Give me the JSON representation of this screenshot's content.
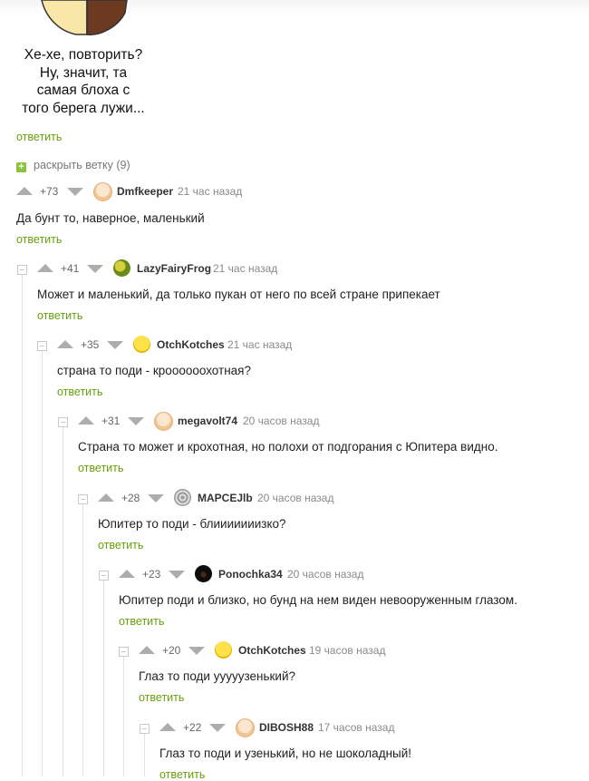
{
  "meme": {
    "caption": "Хе-хе, повторить?\nНу, значит, та\nсамая блоха с\nтого берега лужи..."
  },
  "reply_label": "ответить",
  "expand_branch": "раскрыть ветку (9)",
  "comments": [
    {
      "rating": "+73",
      "author": "Dmfkeeper",
      "time": "21 час назад",
      "text": "Да бунт то, наверное, маленький",
      "avatar": "smiley-face-icon"
    },
    {
      "rating": "+41",
      "author": "LazyFairyFrog",
      "time": "21 час назад",
      "text": "Может и маленький, да только пукан от него по всей стране припекает",
      "avatar": "frog-icon"
    },
    {
      "rating": "+35",
      "author": "OtchKotches",
      "time": "21 час назад",
      "text": "страна то поди - кроооооохотная?",
      "avatar": "winking-face-icon"
    },
    {
      "rating": "+31",
      "author": "megavolt74",
      "time": "20 часов назад",
      "text": "Страна то может и крохотная, но полохи от подгорания с Юпитера видно.",
      "avatar": "smiley-face-icon"
    },
    {
      "rating": "+28",
      "author": "MAPCEJlb",
      "time": "20 часов назад",
      "text": "Юпитер то поди - блииииииизко?",
      "avatar": "pattern-icon"
    },
    {
      "rating": "+23",
      "author": "Ponochka34",
      "time": "20 часов назад",
      "text": "Юпитер поди и близко, но бунд на нем виден невооруженным глазом.",
      "avatar": "dark-creature-icon"
    },
    {
      "rating": "+20",
      "author": "OtchKotches",
      "time": "19 часов назад",
      "text": "Глаз то поди ууууузенький?",
      "avatar": "winking-face-icon"
    },
    {
      "rating": "+22",
      "author": "DIBOSH88",
      "time": "17 часов назад",
      "text": "Глаз то поди и узенький, но не шоколадный!",
      "avatar": "smiley-face-icon"
    }
  ],
  "colors": {
    "reply": "#67a00a",
    "expand_icon": "#8ac43b",
    "vote_arrow": "#adadad"
  }
}
